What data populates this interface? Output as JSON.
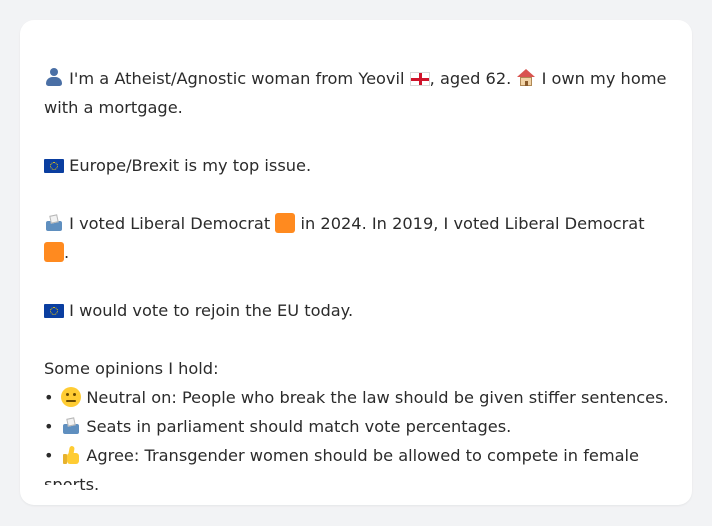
{
  "profile": {
    "line1_part1": "I'm a Atheist/Agnostic woman from Yeovil",
    "line1_part2": ", aged 62.",
    "line1_part3": "I own my home",
    "line2": "with a mortgage.",
    "top_issue": "Europe/Brexit is my top issue.",
    "voted_line1_part1": "I voted Liberal Democrat",
    "voted_line1_part2": "in 2024. In 2019, I voted Liberal Democrat",
    "voted_line2_tail": ".",
    "rejoin": "I would vote to rejoin the EU today."
  },
  "opinions": {
    "heading": "Some opinions I hold:",
    "bullet": "•",
    "items": [
      {
        "icon": "neutral-face-icon",
        "text": "Neutral on: People who break the law should be given stiffer sentences."
      },
      {
        "icon": "ballot-box-icon",
        "text": "Seats in parliament should match vote percentages."
      },
      {
        "icon": "thumbs-up-icon",
        "text_line1": "Agree: Transgender women should be allowed to compete in female",
        "text_line2": "sports."
      }
    ]
  },
  "colors": {
    "background": "#f2f3f5",
    "card": "#ffffff",
    "liberal_democrat": "#ff8a1f",
    "eu_blue": "#0a3ea0"
  }
}
